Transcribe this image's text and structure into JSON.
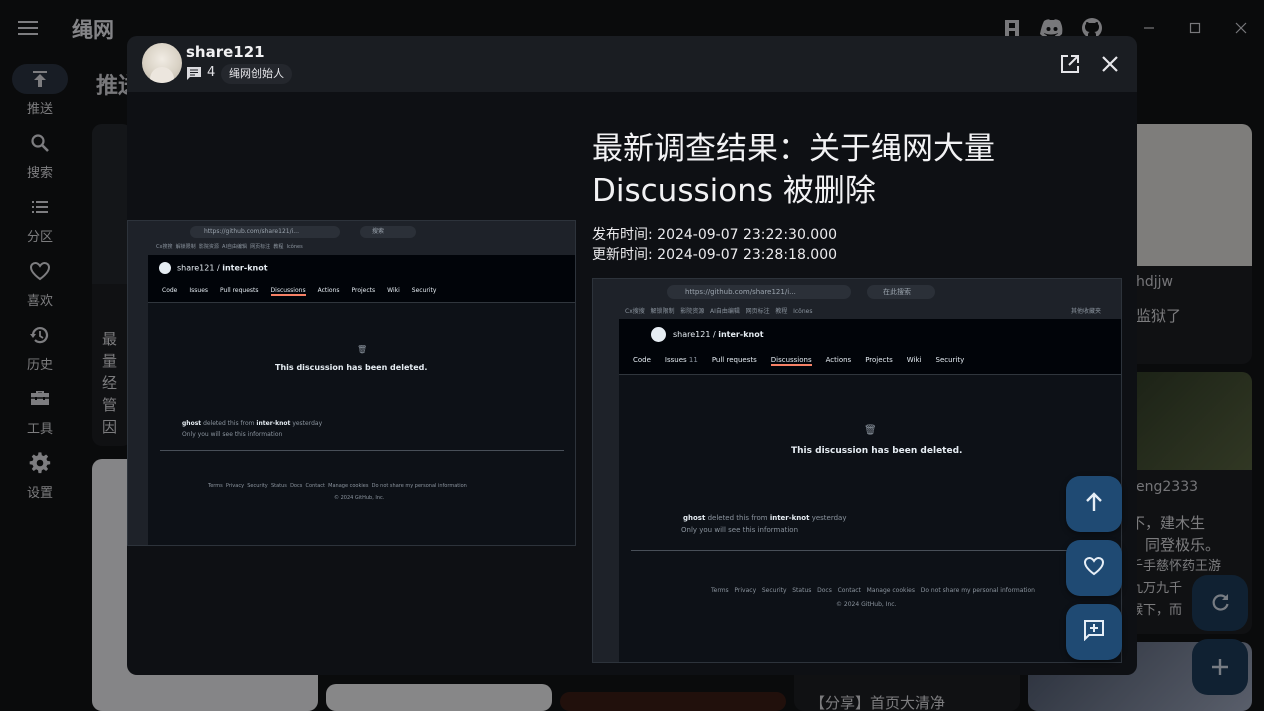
{
  "app": {
    "title": "绳网",
    "window_controls": [
      "minimize-icon",
      "maximize-icon",
      "close-icon"
    ],
    "toolbar_icons": [
      "app-logo-icon",
      "discord-icon",
      "github-icon"
    ]
  },
  "nav": {
    "items": [
      {
        "label": "推送",
        "icon": "upload-icon",
        "active": true
      },
      {
        "label": "搜索",
        "icon": "search-icon"
      },
      {
        "label": "分区",
        "icon": "list-icon"
      },
      {
        "label": "喜欢",
        "icon": "heart-icon"
      },
      {
        "label": "历史",
        "icon": "history-icon"
      },
      {
        "label": "工具",
        "icon": "toolbox-icon"
      },
      {
        "label": "设置",
        "icon": "gear-icon"
      }
    ]
  },
  "feed": {
    "heading": "推送",
    "card_left_lines": [
      "最",
      "量",
      "经",
      "管",
      "因"
    ],
    "card_right_author_1": "hdjjw",
    "card_right_text_1": "监狱了",
    "card_right_author_2": "eng2333",
    "card_right_text_2_lines": [
      "不，建木生",
      "，同登极乐。",
      "千手慈怀药王游",
      "九万九千",
      "喉下，而"
    ],
    "card_bottom_title": "【分享】首页大清净"
  },
  "post": {
    "author": "share121",
    "comment_count": "4",
    "role": "绳网创始人",
    "title": "最新调查结果：关于绳网大量 Discussions 被删除",
    "published_label": "发布时间:",
    "published_at": "2024-09-07 23:22:30.000",
    "updated_label": "更新时间:",
    "updated_at": "2024-09-07 23:28:18.000"
  },
  "screenshot": {
    "url": "https://github.com/share121/i...",
    "url_full": "https://github.com/share121/i...",
    "search_placeholder": "搜索",
    "search_placeholder_full": "在此搜索",
    "bookmarks": [
      "Cx搜搜",
      "解锁限制",
      "影院资源",
      "AI自由编辑",
      "网页标注",
      "教程",
      "Icônes"
    ],
    "bookmark_folder": "其他收藏夹",
    "owner": "share121",
    "repo": "inter-knot",
    "tabs": [
      {
        "label": "Code"
      },
      {
        "label": "Issues",
        "count": "11"
      },
      {
        "label": "Pull requests"
      },
      {
        "label": "Discussions",
        "selected": true
      },
      {
        "label": "Actions"
      },
      {
        "label": "Projects"
      },
      {
        "label": "Wiki"
      },
      {
        "label": "Security"
      }
    ],
    "deleted_message": "This discussion has been deleted.",
    "event_actor": "ghost",
    "event_action": "deleted this from",
    "event_target": "inter-knot",
    "event_time": "yesterday",
    "event_note": "Only you will see this information",
    "footer_links": [
      "Terms",
      "Privacy",
      "Security",
      "Status",
      "Docs",
      "Contact",
      "Manage cookies",
      "Do not share my personal information"
    ],
    "copyright": "© 2024 GitHub, Inc."
  },
  "fabs": [
    "arrow-up-icon",
    "heart-icon",
    "comment-add-icon"
  ],
  "colors": {
    "background": "#121316",
    "modal": "#0e1014",
    "fab": "#1f4a73",
    "github_tab_underline": "#f78166"
  }
}
